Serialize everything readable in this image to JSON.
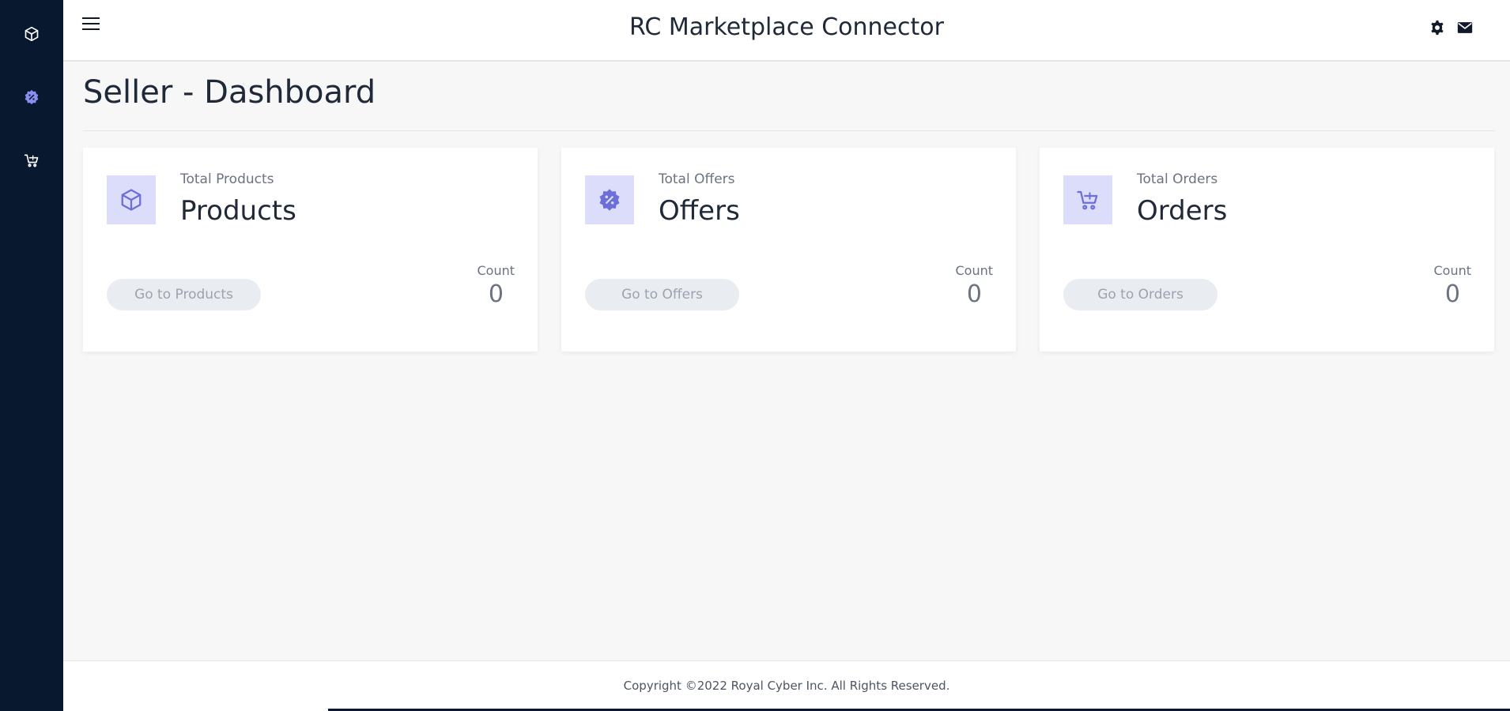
{
  "app": {
    "title": "RC Marketplace Connector"
  },
  "sidebar": {
    "items": [
      {
        "icon": "box-icon"
      },
      {
        "icon": "discount-badge-icon"
      },
      {
        "icon": "cart-add-icon"
      }
    ]
  },
  "header": {
    "menu_icon": "hamburger-icon",
    "settings_icon": "gear-icon",
    "mail_icon": "mail-icon"
  },
  "page": {
    "title": "Seller - Dashboard"
  },
  "cards": [
    {
      "icon": "box-icon",
      "subtitle": "Total Products",
      "heading": "Products",
      "button_label": "Go to Products",
      "count_label": "Count",
      "count": "0"
    },
    {
      "icon": "discount-badge-icon",
      "subtitle": "Total Offers",
      "heading": "Offers",
      "button_label": "Go to Offers",
      "count_label": "Count",
      "count": "0"
    },
    {
      "icon": "cart-add-icon",
      "subtitle": "Total Orders",
      "heading": "Orders",
      "button_label": "Go to Orders",
      "count_label": "Count",
      "count": "0"
    }
  ],
  "footer": {
    "copyright": "Copyright ©2022 Royal Cyber Inc. All Rights Reserved."
  },
  "colors": {
    "sidebar_bg": "#07182f",
    "accent": "#6c6fd8",
    "icon_tile_bg": "#dcdcfb",
    "page_bg": "#f7f7f7"
  }
}
